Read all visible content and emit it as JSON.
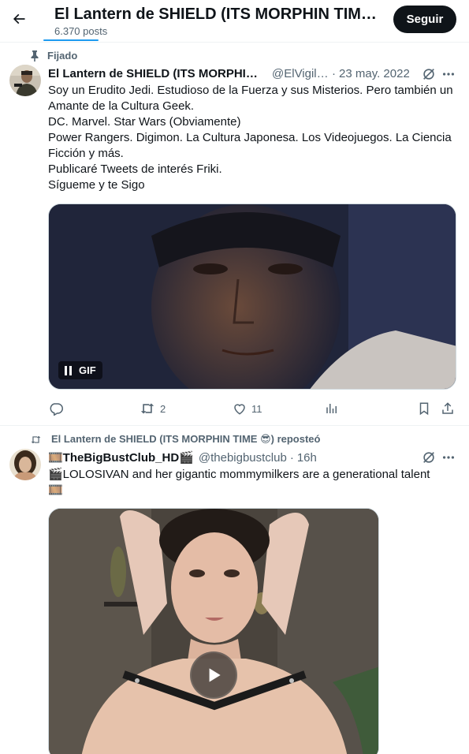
{
  "header": {
    "title": "El Lantern de SHIELD (ITS MORPHIN TIME 😎)",
    "posts_count": "6.370 posts",
    "follow_label": "Seguir"
  },
  "tweet1": {
    "pinned_label": "Fijado",
    "author_name": "El Lantern de SHIELD (ITS MORPHIN TIME 😎)",
    "handle": "@ElVigilante",
    "separator": "·",
    "date": "23 may. 2022",
    "text_lines": [
      "Soy un Erudito Jedi. Estudioso de la Fuerza y sus Misterios. Pero también un Amante de la Cultura Geek.",
      "DC. Marvel. Star Wars (Obviamente)",
      "Power Rangers. Digimon. La Cultura Japonesa. Los Videojuegos. La Ciencia Ficción y más.",
      "Publicaré Tweets de interés Friki.",
      "Sígueme y te Sigo"
    ],
    "media_badge": "GIF",
    "stats": {
      "replies": "",
      "reposts": "2",
      "likes": "11",
      "views": ""
    }
  },
  "tweet2": {
    "repost_context": "El Lantern de SHIELD (ITS MORPHIN TIME 😎) reposteó",
    "author_name": "🎞️TheBigBustClub_HD🎬",
    "handle": "@thebigbustclub",
    "separator": "·",
    "time": "16h",
    "text": "🎬LOLOSIVAN and her gigantic mommymilkers are a generational talent 🎞️"
  },
  "colors": {
    "accent": "#1d9bf0",
    "text_primary": "#0f1419",
    "text_secondary": "#536471",
    "divider": "#eff3f4",
    "button_bg": "#0f1419"
  },
  "icons": {
    "back": "arrow-left-icon",
    "pin": "pin-icon",
    "grok": "grok-icon",
    "more": "more-icon",
    "reply": "reply-icon",
    "repost": "repost-icon",
    "like": "heart-icon",
    "views": "views-icon",
    "bookmark": "bookmark-icon",
    "share": "share-icon",
    "play": "play-icon",
    "pause": "pause-icon"
  }
}
